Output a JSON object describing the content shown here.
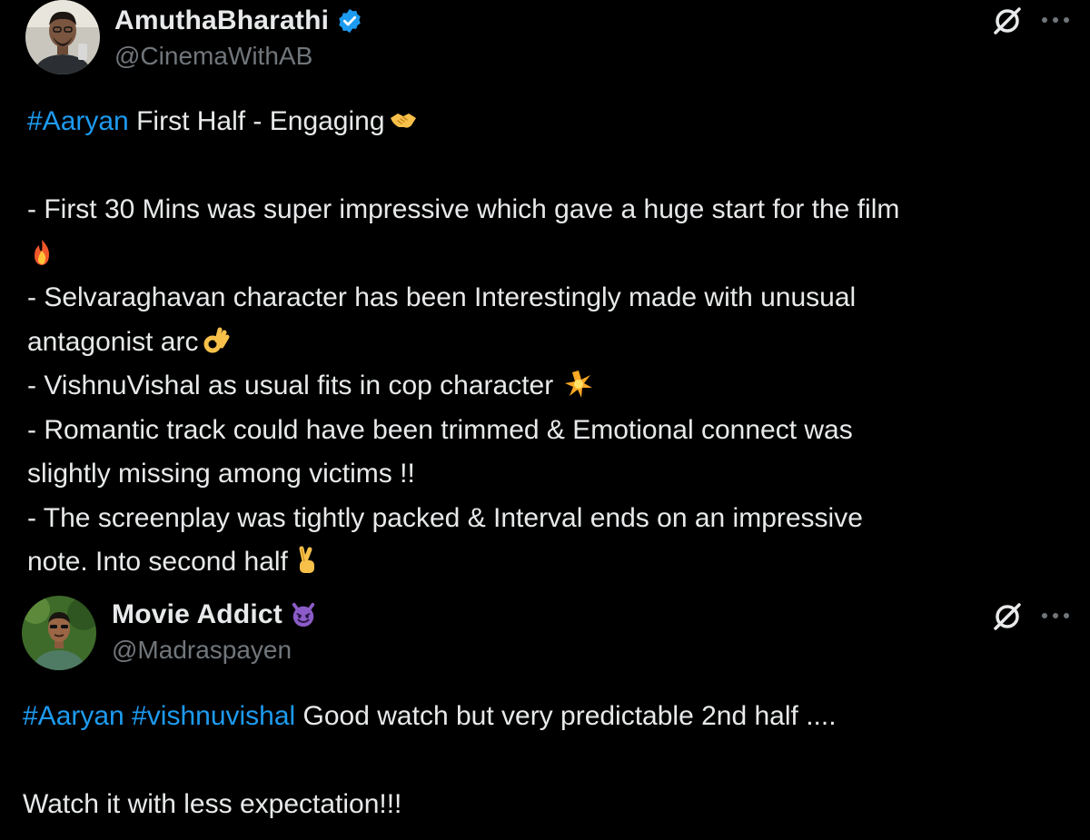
{
  "tweets": [
    {
      "author": {
        "name": "AmuthaBharathi",
        "handle": "@CinemaWithAB",
        "verified": true,
        "badge_color": "#1d9bf0"
      },
      "hashtag": "#Aaryan",
      "title_text": " First Half - Engaging",
      "lines": [
        "- First 30 Mins was super impressive which gave a huge start for the film",
        "- Selvaraghavan character has been Interestingly made with unusual",
        "antagonist arc",
        "- VishnuVishal as usual fits in cop character",
        "- Romantic track could have been trimmed & Emotional connect was",
        "slightly missing among victims !!",
        "- The screenplay was tightly packed & Interval ends on an impressive",
        "note. Into second half"
      ],
      "emojis": [
        "handshake-emoji",
        "fire-emoji",
        "ok-hand-emoji",
        "sparkle-star-emoji",
        "crossed-fingers-emoji"
      ]
    },
    {
      "author": {
        "name": "Movie Addict",
        "handle": "@Madraspayen",
        "badge": "smiling-devil-emoji"
      },
      "hashtags": [
        "#Aaryan",
        "#vishnuvishal"
      ],
      "text": " Good watch but very predictable 2nd half ....",
      "text2": "Watch it with less expectation!!!"
    }
  ],
  "colors": {
    "background": "#000000",
    "text": "#e7e9ea",
    "secondary": "#71767b",
    "link": "#1d9bf0"
  }
}
